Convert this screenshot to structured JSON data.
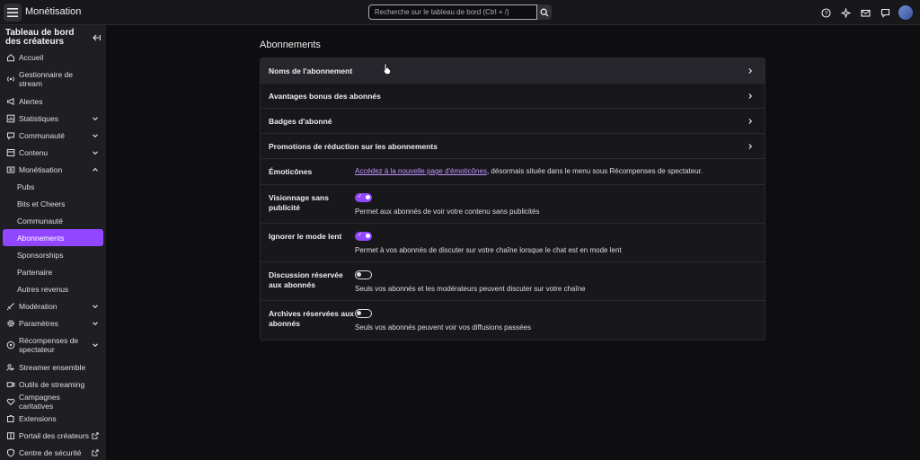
{
  "topbar": {
    "title": "Monétisation",
    "search_placeholder": "Recherche sur le tableau de bord (Ctrl + /)"
  },
  "sidebar": {
    "heading": "Tableau de bord des créateurs",
    "items": [
      {
        "label": "Accueil",
        "icon": "home-icon"
      },
      {
        "label": "Gestionnaire de stream",
        "icon": "stream-manager-icon"
      },
      {
        "label": "Alertes",
        "icon": "megaphone-icon"
      },
      {
        "label": "Statistiques",
        "icon": "stats-icon",
        "chevron": "down"
      },
      {
        "label": "Communauté",
        "icon": "community-icon",
        "chevron": "down"
      },
      {
        "label": "Contenu",
        "icon": "content-icon",
        "chevron": "down"
      },
      {
        "label": "Monétisation",
        "icon": "monetization-icon",
        "chevron": "up"
      }
    ],
    "sub_items": [
      "Pubs",
      "Bits et Cheers",
      "Communauté",
      "Abonnements",
      "Sponsorships",
      "Partenaire",
      "Autres revenus"
    ],
    "items_after": [
      {
        "label": "Modération",
        "icon": "sword-icon",
        "chevron": "down"
      },
      {
        "label": "Paramètres",
        "icon": "gear-icon",
        "chevron": "down"
      },
      {
        "label": "Récompenses de spectateur",
        "icon": "rewards-icon",
        "chevron": "down"
      },
      {
        "label": "Streamer ensemble",
        "icon": "users-icon"
      },
      {
        "label": "Outils de streaming",
        "icon": "camera-icon"
      },
      {
        "label": "Campagnes caritatives",
        "icon": "charity-icon"
      },
      {
        "label": "Extensions",
        "icon": "puzzle-icon"
      },
      {
        "label": "Portail des créateurs",
        "icon": "book-icon",
        "external": true
      },
      {
        "label": "Centre de sécurité",
        "icon": "shield-icon",
        "external": true
      }
    ]
  },
  "main": {
    "section_title": "Abonnements",
    "links": [
      "Noms de l'abonnement",
      "Avantages bonus des abonnés",
      "Badges d'abonné",
      "Promotions de réduction sur les abonnements"
    ],
    "emotes": {
      "label": "Émoticônes",
      "link_text": "Accédez à la nouvelle page d'émoticônes",
      "rest_text": ", désormais située dans le menu sous Récompenses de spectateur."
    },
    "settings": [
      {
        "label": "Visionnage sans publicité",
        "desc": "Permet aux abonnés de voir votre contenu sans publicités",
        "on": true
      },
      {
        "label": "Ignorer le mode lent",
        "desc": "Permet à vos abonnés de discuter sur votre chaîne lorsque le chat est en mode lent",
        "on": true
      },
      {
        "label": "Discussion réservée aux abonnés",
        "desc": "Seuls vos abonnés et les modérateurs peuvent discuter sur votre chaîne",
        "on": false
      },
      {
        "label": "Archives réservées aux abonnés",
        "desc": "Seuls vos abonnés peuvent voir vos diffusions passées",
        "on": false
      }
    ]
  },
  "colors": {
    "accent": "#9147ff",
    "link": "#bf94ff",
    "background": "#0e0e10",
    "panel": "#18181b"
  }
}
